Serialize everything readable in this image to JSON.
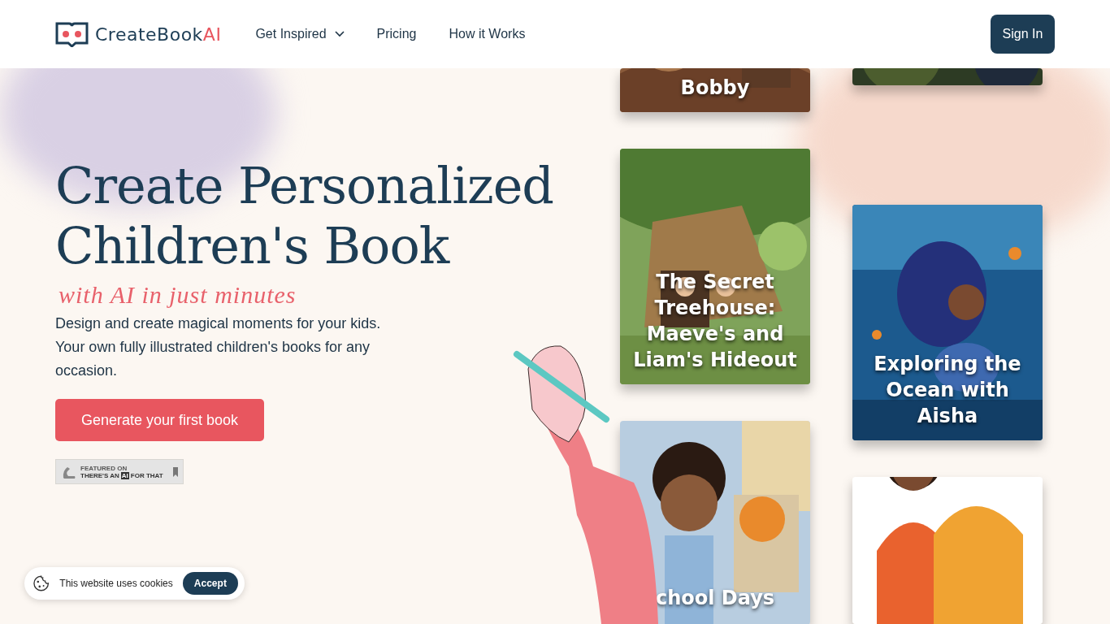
{
  "header": {
    "logo": {
      "name": "CreateBook",
      "suffix": "AI"
    },
    "nav": [
      {
        "label": "Get Inspired",
        "kind": "dropdown"
      },
      {
        "label": "Pricing",
        "kind": "link"
      },
      {
        "label": "How it Works",
        "kind": "link"
      }
    ],
    "sign_in": "Sign In"
  },
  "hero": {
    "title": "Create Personalized Children's Book",
    "tagline": "with AI in just minutes",
    "description": "Design and create magical moments for your kids. Your own  fully illustrated children's books for any occasion.",
    "cta": "Generate your first book",
    "badge": {
      "small": "FEATURED ON",
      "before": "THERE'S AN",
      "highlight": "AI",
      "after": "FOR THAT"
    }
  },
  "covers_left": [
    {
      "title": "Bobby"
    },
    {
      "title": "The Secret Treehouse: Maeve's and Liam's Hideout"
    },
    {
      "title": "chool Days"
    }
  ],
  "covers_right": [
    {
      "kind": "picture"
    },
    {
      "title": "Exploring the Ocean with Aisha"
    },
    {
      "kind": "picture"
    }
  ],
  "cookie": {
    "message": "This website uses cookies",
    "button": "Accept"
  }
}
